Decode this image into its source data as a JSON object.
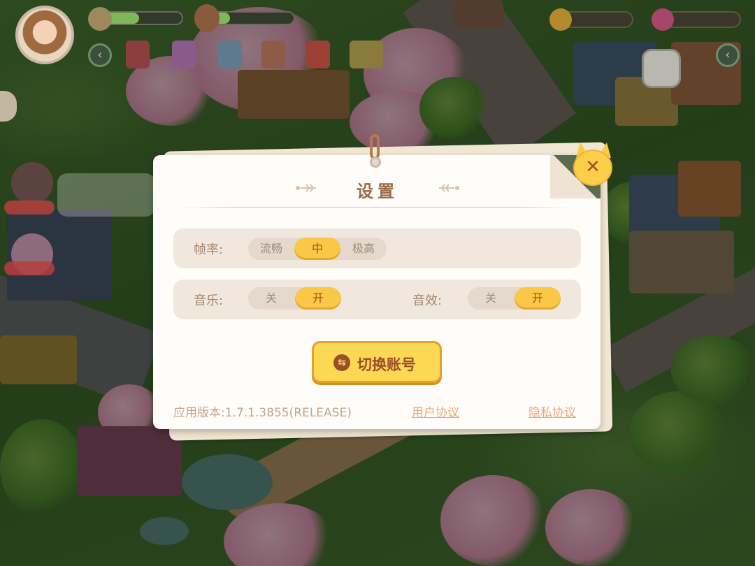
{
  "dialog": {
    "title": "设置",
    "frame_rate": {
      "label": "帧率:",
      "options": [
        "流畅",
        "中",
        "极高"
      ],
      "selected": "中"
    },
    "music": {
      "label": "音乐:",
      "options": [
        "关",
        "开"
      ],
      "selected": "开"
    },
    "sound_effects": {
      "label": "音效:",
      "options": [
        "关",
        "开"
      ],
      "selected": "开"
    },
    "switch_account_label": "切换账号",
    "version_text": "应用版本:1.7.1.3855(RELEASE)",
    "user_agreement": "用户协议",
    "privacy_policy": "隐私协议",
    "close_icon": "close-icon"
  },
  "colors": {
    "selected_option": "#fbc747",
    "title": "#9c6a48",
    "link": "#f1a677",
    "dialog_bg": "#fffdf9"
  }
}
